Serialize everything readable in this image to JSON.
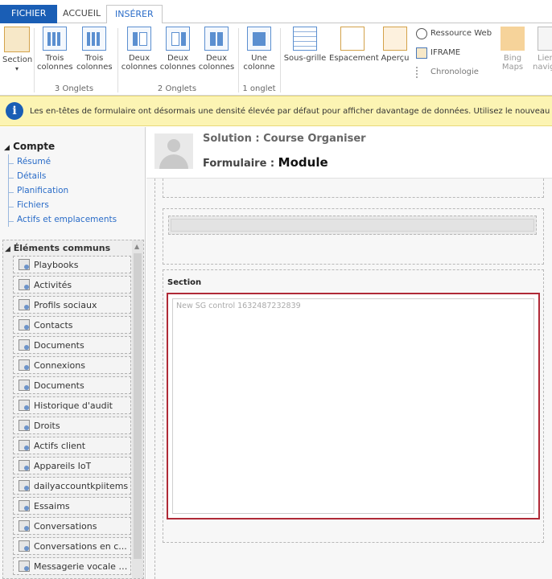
{
  "tabs": {
    "file": "FICHIER",
    "home": "ACCUEIL",
    "insert": "INSÉRER"
  },
  "ribbon": {
    "section": {
      "line1": "Section",
      "arrow": "▾"
    },
    "three_col_1": {
      "line1": "Trois",
      "line2": "colonnes"
    },
    "three_col_2": {
      "line1": "Trois",
      "line2": "colonnes"
    },
    "group_3tabs": "3 Onglets",
    "two_col_1": {
      "line1": "Deux",
      "line2": "colonnes"
    },
    "two_col_2": {
      "line1": "Deux",
      "line2": "colonnes"
    },
    "two_col_3": {
      "line1": "Deux",
      "line2": "colonnes"
    },
    "group_2tabs": "2 Onglets",
    "one_col": {
      "line1": "Une",
      "line2": "colonne"
    },
    "group_1tab": "1 onglet",
    "subgrid": "Sous-grille",
    "spacer": "Espacement",
    "preview": "Aperçu",
    "web_resource": "Ressource Web",
    "iframe": "IFRAME",
    "timeline": "Chronologie",
    "bing": {
      "line1": "Bing",
      "line2": "Maps"
    },
    "nav": {
      "line1": "Lien",
      "line2": "navig"
    }
  },
  "notice": {
    "text": "Les en-têtes de formulaire ont désormais une densité élevée par défaut pour afficher davantage de données. Utilisez le nouveau conce"
  },
  "leftnav": {
    "compte_title": "Compte",
    "compte_links": [
      "Résumé",
      "Détails",
      "Planification",
      "Fichiers",
      "Actifs et emplacements"
    ],
    "common_title": "Éléments communs",
    "common_items": [
      "Playbooks",
      "Activités",
      "Profils sociaux",
      "Contacts",
      "Documents",
      "Connexions",
      "Documents",
      "Historique d'audit",
      "Droits",
      "Actifs client",
      "Appareils IoT",
      "dailyaccountkpiitems",
      "Essaims",
      "Conversations",
      "Conversations en c...",
      "Messagerie vocale (..."
    ]
  },
  "header": {
    "solution_label": "Solution : ",
    "solution_name": "Course Organiser",
    "form_label": "Formulaire : ",
    "form_name": "Module"
  },
  "canvas": {
    "section_label": "Section",
    "subgrid_control": "New SG control 1632487232839"
  }
}
